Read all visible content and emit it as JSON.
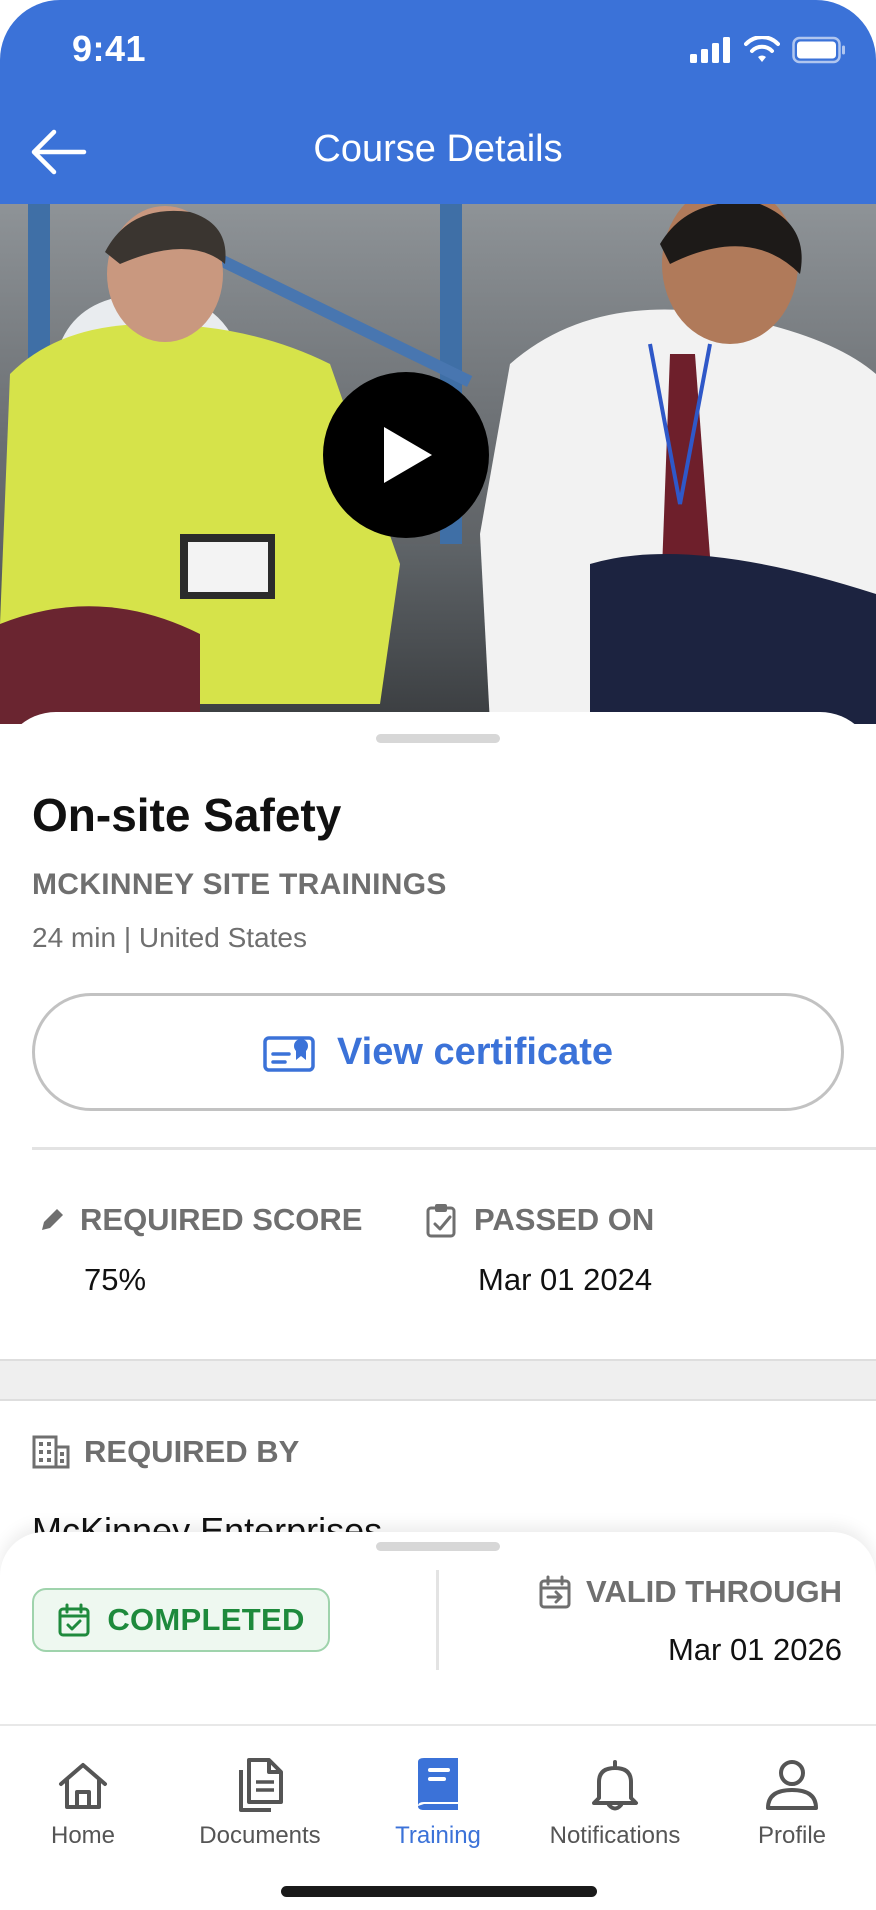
{
  "status_bar": {
    "time": "9:41"
  },
  "header": {
    "title": "Course Details"
  },
  "course": {
    "title": "On-site Safety",
    "provider": "MCKINNEY SITE TRAININGS",
    "meta": "24 min | United States",
    "certificate_button": "View certificate"
  },
  "stats": {
    "required_score_label": "REQUIRED SCORE",
    "required_score_value": "75%",
    "passed_on_label": "PASSED ON",
    "passed_on_value": "Mar 01 2024"
  },
  "required_by": {
    "label": "REQUIRED BY",
    "value": "McKinney Enterprises"
  },
  "status_card": {
    "badge": "COMPLETED",
    "valid_label": "VALID THROUGH",
    "valid_value": "Mar 01 2026"
  },
  "tabbar": {
    "items": [
      {
        "label": "Home",
        "icon": "home-icon",
        "active": false
      },
      {
        "label": "Documents",
        "icon": "documents-icon",
        "active": false
      },
      {
        "label": "Training",
        "icon": "book-icon",
        "active": true
      },
      {
        "label": "Notifications",
        "icon": "bell-icon",
        "active": false
      },
      {
        "label": "Profile",
        "icon": "profile-icon",
        "active": false
      }
    ]
  },
  "colors": {
    "brand_blue": "#3b72d8",
    "success_green": "#1e8a3c",
    "muted_gray": "#6f6f6f"
  }
}
